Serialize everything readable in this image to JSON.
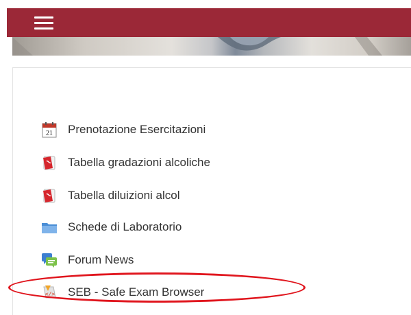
{
  "navbar": {
    "menu_icon": "hamburger-menu-icon",
    "color": "#9b2837"
  },
  "activities": [
    {
      "label": "Prenotazione Esercitazioni",
      "icon": "calendar-icon",
      "calendar_day": "21"
    },
    {
      "label": "Tabella gradazioni alcoliche",
      "icon": "pdf-icon"
    },
    {
      "label": "Tabella diluizioni alcol",
      "icon": "pdf-icon"
    },
    {
      "label": "Schede di Laboratorio",
      "icon": "folder-icon"
    },
    {
      "label": "Forum News",
      "icon": "forum-icon"
    },
    {
      "label": "SEB - Safe Exam Browser",
      "icon": "seb-icon"
    }
  ],
  "highlight": {
    "color": "#e0151d",
    "target": "SEB - Safe Exam Browser"
  }
}
